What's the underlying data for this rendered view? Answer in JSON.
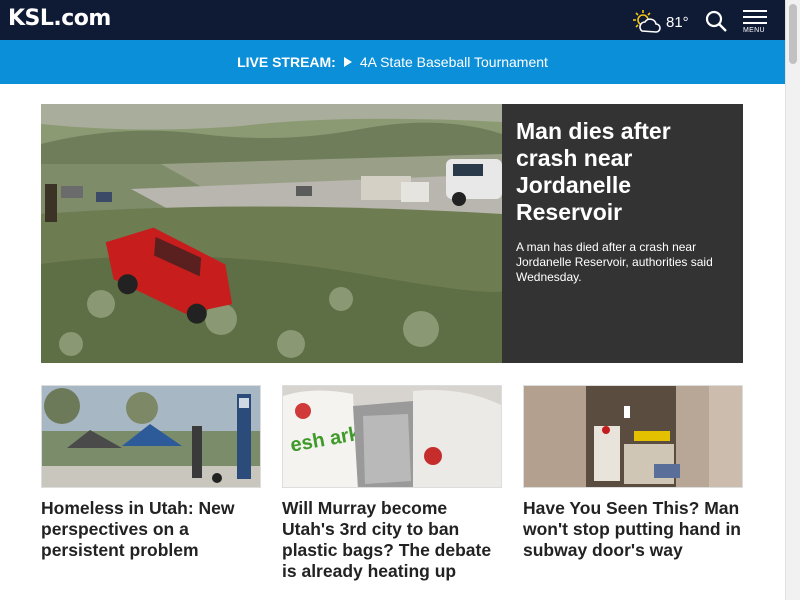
{
  "header": {
    "logo": "KSL.com",
    "weather_temp": "81°",
    "menu_label": "MENU"
  },
  "livestream": {
    "label": "LIVE STREAM:",
    "title": "4A State Baseball Tournament"
  },
  "hero": {
    "title": "Man dies after crash near Jordanelle Reservoir",
    "summary": "A man has died after a crash near Jordanelle Reservoir, authorities said Wednesday."
  },
  "cards": [
    {
      "title": "Homeless in Utah: New perspectives on a persistent problem"
    },
    {
      "title": "Will Murray become Utah's 3rd city to ban plastic bags? The debate is already heating up"
    },
    {
      "title": "Have You Seen This? Man won't stop putting hand in subway door's way"
    }
  ],
  "image_text": {
    "bag_text": "esh arket"
  },
  "colors": {
    "topbar": "#0f1a35",
    "livebar": "#0b8fd8",
    "hero_panel": "#333333"
  }
}
